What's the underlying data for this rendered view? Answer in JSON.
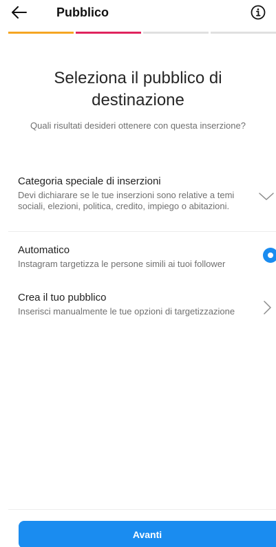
{
  "header": {
    "title": "Pubblico",
    "back_icon": "arrow-left-icon",
    "info_icon": "info-icon"
  },
  "progress": {
    "segments": 4,
    "completed": 2,
    "colors": [
      "#f5a623",
      "#e0245e",
      "#e0e0e0",
      "#e0e0e0"
    ]
  },
  "hero": {
    "title": "Seleziona il pubblico di destinazione",
    "subtitle": "Quali risultati desideri ottenere con questa inserzione?"
  },
  "options": [
    {
      "title": "Categoria speciale di inserzioni",
      "description": "Devi dichiarare se le tue inserzioni sono relative a temi sociali, elezioni, politica, credito, impiego o abitazioni.",
      "action_icon": "chevron-down-icon"
    },
    {
      "title": "Automatico",
      "description": "Instagram targetizza le persone simili ai tuoi follower",
      "action_icon": "radio-selected-icon",
      "selected": true
    },
    {
      "title": "Crea il tuo pubblico",
      "description": "Inserisci manualmente le tue opzioni di targetizzazione",
      "action_icon": "chevron-right-icon"
    }
  ],
  "cta": {
    "label": "Avanti"
  },
  "colors": {
    "accent": "#1a8cf0",
    "progress_orange": "#f5a623",
    "progress_pink": "#e0245e",
    "muted_text": "#6f6f6f"
  }
}
